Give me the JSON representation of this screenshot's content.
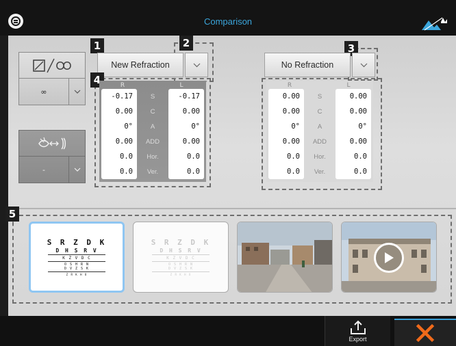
{
  "header": {
    "title": "Comparison"
  },
  "left_controls": {
    "distance": {
      "value": "∞"
    },
    "occlusion": {
      "value": "-"
    }
  },
  "refraction_a": {
    "label": "New Refraction",
    "headers": {
      "right": "R",
      "left": "L"
    },
    "rows": [
      {
        "param": "S",
        "r": "-0.17",
        "l": "-0.17"
      },
      {
        "param": "C",
        "r": "0.00",
        "l": "0.00"
      },
      {
        "param": "A",
        "r": "0°",
        "l": "0°"
      },
      {
        "param": "ADD",
        "r": "0.00",
        "l": "0.00"
      },
      {
        "param": "Hor.",
        "r": "0.0",
        "l": "0.0"
      },
      {
        "param": "Ver.",
        "r": "0.0",
        "l": "0.0"
      }
    ]
  },
  "refraction_b": {
    "label": "No Refraction",
    "headers": {
      "right": "R",
      "left": "L"
    },
    "rows": [
      {
        "param": "S",
        "r": "0.00",
        "l": "0.00"
      },
      {
        "param": "C",
        "r": "0.00",
        "l": "0.00"
      },
      {
        "param": "A",
        "r": "0°",
        "l": "0°"
      },
      {
        "param": "ADD",
        "r": "0.00",
        "l": "0.00"
      },
      {
        "param": "Hor.",
        "r": "0.0",
        "l": "0.0"
      },
      {
        "param": "Ver.",
        "r": "0.0",
        "l": "0.0"
      }
    ]
  },
  "markers": [
    "1",
    "2",
    "3",
    "4",
    "5"
  ],
  "thumbnails": {
    "chart": {
      "rows": [
        "S R Z D K",
        "D H S R V",
        "K Z V D C",
        "O S H R N",
        "D V Z S K",
        "Z R K H O"
      ]
    }
  },
  "footer": {
    "export_label": "Export"
  },
  "colors": {
    "accent": "#3ba6dc",
    "close": "#f06a1a",
    "selected_border": "#8fc6f2"
  }
}
